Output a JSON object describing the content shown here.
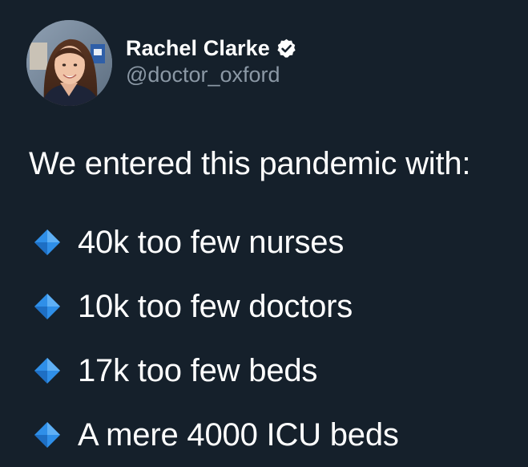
{
  "tweet": {
    "author": {
      "display_name": "Rachel Clarke",
      "handle": "@doctor_oxford",
      "verified": true,
      "avatar_icon": "profile-photo",
      "verified_icon": "verified-badge-icon"
    },
    "intro": "We entered this pandemic with:",
    "bullet_icon": "small-blue-diamond-icon",
    "items": [
      {
        "text": "40k too few nurses"
      },
      {
        "text": "10k too few doctors"
      },
      {
        "text": "17k too few beds"
      },
      {
        "text": "A mere 4000 ICU beds"
      }
    ]
  },
  "colors": {
    "background": "#15202b",
    "text": "#ffffff",
    "secondary_text": "#8b98a5",
    "bullet_blue": "#2f8fe8"
  }
}
